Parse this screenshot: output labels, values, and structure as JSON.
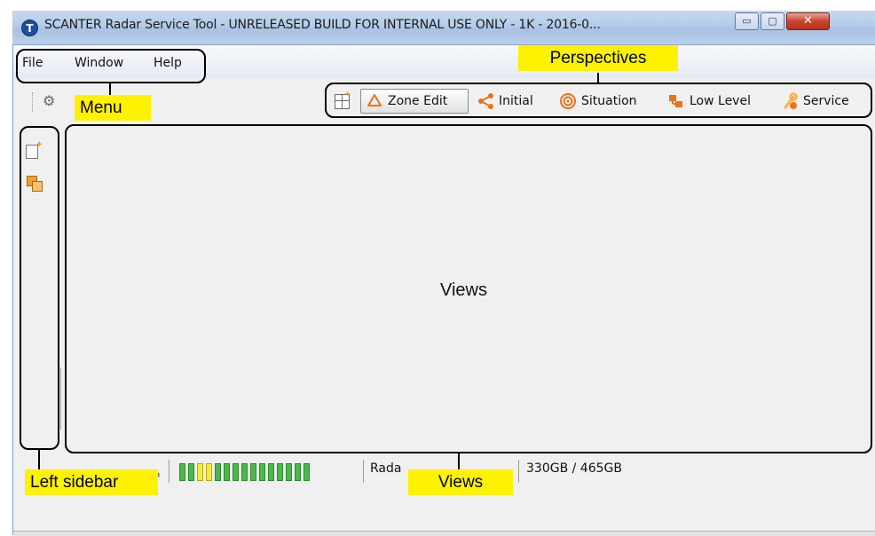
{
  "window": {
    "title": "SCANTER Radar Service Tool - UNRELEASED BUILD FOR INTERNAL USE ONLY - 1K - 2016-0...",
    "logo_letter": "T",
    "controls": {
      "minimize": "▭",
      "maximize": "▢",
      "close": "✕"
    }
  },
  "menu": {
    "items": [
      "File",
      "Window",
      "Help"
    ]
  },
  "perspectives": [
    {
      "label": "Zone Edit",
      "icon": "zone-edit-icon",
      "active": true
    },
    {
      "label": "Initial",
      "icon": "share-icon",
      "active": false
    },
    {
      "label": "Situation",
      "icon": "target-icon",
      "active": false
    },
    {
      "label": "Low Level",
      "icon": "low-level-icon",
      "active": false
    },
    {
      "label": "Service",
      "icon": "service-icon",
      "active": false
    }
  ],
  "views": {
    "label": "Views"
  },
  "status": {
    "signal_segments": [
      "green",
      "green",
      "yellow",
      "yellow",
      "green",
      "green",
      "green",
      "green",
      "green",
      "green",
      "green",
      "green",
      "green",
      "green",
      "green"
    ],
    "radar_text": "Rada",
    "disk_text": "330GB / 465GB"
  },
  "annotations": {
    "menu": "Menu",
    "perspectives": "Perspectives",
    "left_sidebar": "Left sidebar",
    "views": "Views"
  },
  "colors": {
    "callout": "#fff200",
    "accent_orange": "#e8731a",
    "signal_green": "#4ab84a",
    "signal_yellow": "#f3ec3a"
  }
}
